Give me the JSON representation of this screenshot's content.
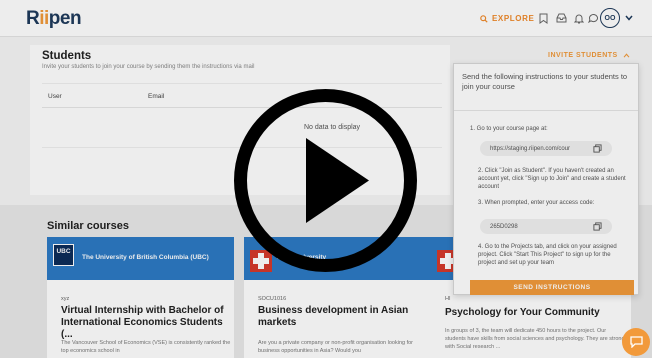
{
  "nav": {
    "logo_pre": "R",
    "logo_ii": "ii",
    "logo_post": "pen",
    "explore_label": "EXPLORE",
    "avatar_initials": "OO"
  },
  "students": {
    "title": "Students",
    "subtitle": "Invite your students to join your course by sending them the instructions via mail",
    "columns": [
      "User",
      "Email"
    ],
    "empty_text": "No data to display",
    "invite_button_label": "INVITE STUDENTS"
  },
  "invite_popover": {
    "intro": "Send the following instructions to your students to join your course",
    "step1": "1. Go to your course page at:",
    "course_url": "https://staging.riipen.com/cour",
    "step2": "2. Click \"Join as Student\". If you haven't created an account yet, click \"Sign up to Join\" and create a student account",
    "step3": "3. When prompted, enter your access code:",
    "access_code": "265D0298",
    "step4": "4. Go to the Projects tab, and click on your assigned project. Click \"Start This Project\" to sign up for the project and set up your team",
    "send_label": "SEND INSTRUCTIONS"
  },
  "similar": {
    "title": "Similar courses",
    "courses": [
      {
        "logo_text": "UBC",
        "org": "The University of British Columbia (UBC)",
        "code": "xyz",
        "title": "Virtual Internship with Bachelor of International Economics Students (...",
        "desc": "The Vancouver School of Economics (VSE) is consistently ranked the top economics school in"
      },
      {
        "org": "RMIT University",
        "code": "SOCU1016",
        "title": "Business development in Asian markets",
        "desc": "Are you a private company or non-profit organisation looking for business opportunities in Asia? Would you"
      },
      {
        "code": "HI",
        "title": "Psychology for Your Community",
        "desc": "In groups of 3, the team will dedicate 450 hours to the project. Our students have skills from social sciences and psychology. They are strong with Social research ..."
      }
    ]
  },
  "colors": {
    "accent": "#f29a3b",
    "brand_navy": "#1f3b5c",
    "card_header_blue": "#2d7ac4"
  }
}
